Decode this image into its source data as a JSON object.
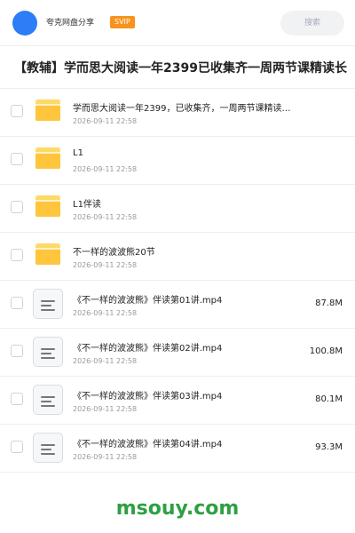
{
  "header": {
    "site_name": "夸克网盘分享",
    "badge": "SVIP",
    "search_placeholder": "搜索"
  },
  "title": "【教辅】学而思大阅读一年2399已收集齐一周两节课精读长",
  "rows": [
    {
      "type": "folder",
      "name": "学而思大阅读一年2399，已收集齐，一周两节课精读…",
      "date": "2026-09-11 22:58",
      "size": ""
    },
    {
      "type": "folder",
      "name": "L1",
      "date": "2026-09-11 22:58",
      "size": ""
    },
    {
      "type": "folder",
      "name": "L1伴读",
      "date": "2026-09-11 22:58",
      "size": ""
    },
    {
      "type": "folder",
      "name": "不一样的波波熊20节",
      "date": "2026-09-11 22:58",
      "size": ""
    },
    {
      "type": "file",
      "name": "《不一样的波波熊》伴读第01讲.mp4",
      "date": "2026-09-11 22:58",
      "size": "87.8M"
    },
    {
      "type": "file",
      "name": "《不一样的波波熊》伴读第02讲.mp4",
      "date": "2026-09-11 22:58",
      "size": "100.8M"
    },
    {
      "type": "file",
      "name": "《不一样的波波熊》伴读第03讲.mp4",
      "date": "2026-09-11 22:58",
      "size": "80.1M"
    },
    {
      "type": "file",
      "name": "《不一样的波波熊》伴读第04讲.mp4",
      "date": "2026-09-11 22:58",
      "size": "93.3M"
    }
  ],
  "footer": {
    "watermark": "msouy.com"
  },
  "colors": {
    "accent": "#2d7df6",
    "svip": "#f7931e",
    "folder": "#ffc53d",
    "watermark": "#2ea043"
  }
}
